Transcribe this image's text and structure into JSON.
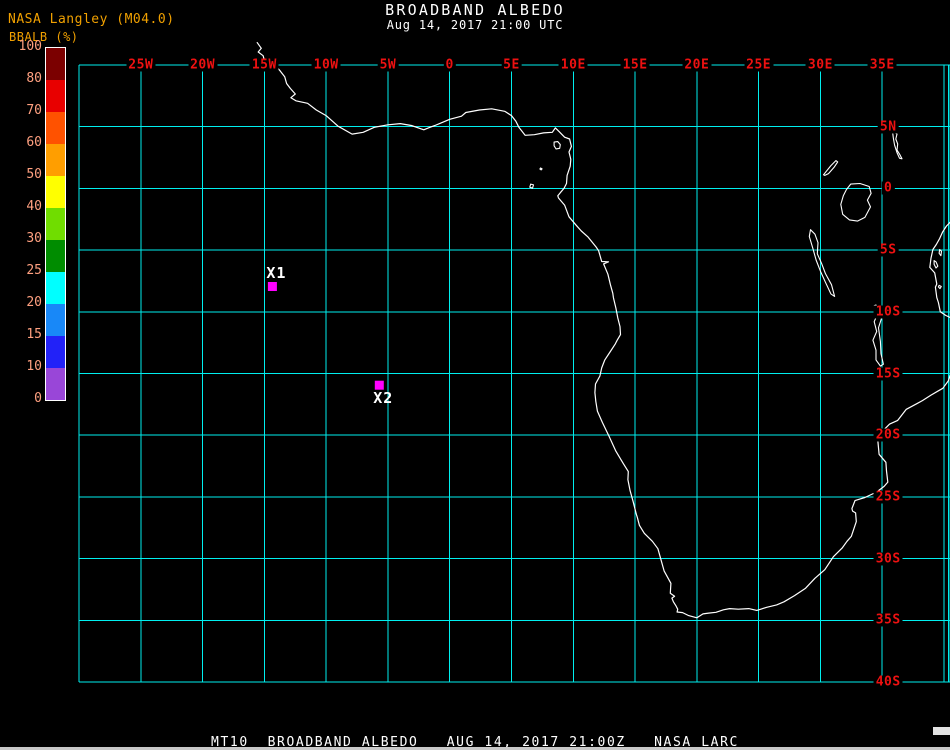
{
  "header": {
    "source": "NASA Langley (M04.0)",
    "title": "BROADBAND ALBEDO",
    "subtitle": "Aug 14, 2017 21:00 UTC"
  },
  "colorbar": {
    "label": "BBALB (%)",
    "tick_values": [
      "100",
      "80",
      "70",
      "60",
      "50",
      "40",
      "30",
      "25",
      "20",
      "15",
      "10",
      "0"
    ],
    "segment_colors": [
      "#7B0000",
      "#E80000",
      "#FF5200",
      "#FF9E00",
      "#FFFF00",
      "#70DD00",
      "#008C00",
      "#00FFFF",
      "#1888F8",
      "#2222F8",
      "#9946D8"
    ],
    "text_color": "#FFA080",
    "source_text_color": "#F0A000"
  },
  "map": {
    "lon_min": -30,
    "lon_max": 40,
    "lat_min": -40,
    "lat_max": 10,
    "grid_color": "#00EEEE",
    "label_color": "#EE1111",
    "coast_color": "#FFFFFF",
    "background": "#000000",
    "lon_labels": [
      {
        "text": "25W",
        "lon": -25
      },
      {
        "text": "20W",
        "lon": -20
      },
      {
        "text": "15W",
        "lon": -15
      },
      {
        "text": "10W",
        "lon": -10
      },
      {
        "text": "5W",
        "lon": -5
      },
      {
        "text": "0",
        "lon": 0
      },
      {
        "text": "5E",
        "lon": 5
      },
      {
        "text": "10E",
        "lon": 10
      },
      {
        "text": "15E",
        "lon": 15
      },
      {
        "text": "20E",
        "lon": 20
      },
      {
        "text": "25E",
        "lon": 25
      },
      {
        "text": "30E",
        "lon": 30
      },
      {
        "text": "35E",
        "lon": 35
      }
    ],
    "lat_labels": [
      {
        "text": "5N",
        "lat": 5
      },
      {
        "text": "0",
        "lat": 0
      },
      {
        "text": "5S",
        "lat": -5
      },
      {
        "text": "10S",
        "lat": -10
      },
      {
        "text": "15S",
        "lat": -15
      },
      {
        "text": "20S",
        "lat": -20
      },
      {
        "text": "25S",
        "lat": -25
      },
      {
        "text": "30S",
        "lat": -30
      },
      {
        "text": "35S",
        "lat": -35
      },
      {
        "text": "40S",
        "lat": -40
      }
    ],
    "markers": [
      {
        "label": "X1",
        "lon": -14.35,
        "lat": -7.95,
        "label_pos": "above",
        "color": "#FF00FF"
      },
      {
        "label": "X2",
        "lon": -5.7,
        "lat": -15.95,
        "label_pos": "below",
        "color": "#FF00FF"
      }
    ]
  },
  "geo": {
    "coastlines": [
      {
        "name": "africa-west-south-coast",
        "points": [
          [
            -15.6,
            11.85
          ],
          [
            -15.25,
            11.35
          ],
          [
            -15.5,
            11.05
          ],
          [
            -15.1,
            10.75
          ],
          [
            -14.95,
            10.2
          ],
          [
            -14.55,
            10.0
          ],
          [
            -14.0,
            9.85
          ],
          [
            -13.7,
            9.5
          ],
          [
            -13.35,
            9.05
          ],
          [
            -13.2,
            8.5
          ],
          [
            -12.9,
            8.1
          ],
          [
            -12.5,
            7.65
          ],
          [
            -12.85,
            7.35
          ],
          [
            -12.45,
            7.1
          ],
          [
            -11.5,
            6.9
          ],
          [
            -10.8,
            6.35
          ],
          [
            -10.0,
            5.9
          ],
          [
            -9.05,
            5.05
          ],
          [
            -7.9,
            4.4
          ],
          [
            -7.0,
            4.55
          ],
          [
            -6.1,
            4.95
          ],
          [
            -5.0,
            5.15
          ],
          [
            -4.0,
            5.25
          ],
          [
            -3.1,
            5.1
          ],
          [
            -2.1,
            4.75
          ],
          [
            -1.6,
            4.95
          ],
          [
            -1.2,
            5.1
          ],
          [
            -0.6,
            5.35
          ],
          [
            0.0,
            5.6
          ],
          [
            0.95,
            5.85
          ],
          [
            1.3,
            6.15
          ],
          [
            2.4,
            6.35
          ],
          [
            3.4,
            6.45
          ],
          [
            4.45,
            6.25
          ],
          [
            5.0,
            5.9
          ],
          [
            5.35,
            5.45
          ],
          [
            5.6,
            4.95
          ],
          [
            6.1,
            4.3
          ],
          [
            6.85,
            4.35
          ],
          [
            7.6,
            4.5
          ],
          [
            8.3,
            4.55
          ],
          [
            8.55,
            4.9
          ],
          [
            8.85,
            4.6
          ],
          [
            9.3,
            4.15
          ],
          [
            9.7,
            4.0
          ],
          [
            9.85,
            3.4
          ],
          [
            9.65,
            2.95
          ],
          [
            9.8,
            2.35
          ],
          [
            9.75,
            1.8
          ],
          [
            9.5,
            1.05
          ],
          [
            9.45,
            0.4
          ],
          [
            9.25,
            0.0
          ],
          [
            8.95,
            -0.35
          ],
          [
            8.75,
            -0.6
          ],
          [
            8.8,
            -0.78
          ],
          [
            9.3,
            -1.35
          ],
          [
            9.65,
            -2.3
          ],
          [
            10.2,
            -2.95
          ],
          [
            10.65,
            -3.45
          ],
          [
            11.2,
            -3.95
          ],
          [
            11.85,
            -4.75
          ],
          [
            12.05,
            -5.05
          ],
          [
            12.25,
            -5.75
          ],
          [
            12.3,
            -5.92
          ],
          [
            12.85,
            -5.95
          ],
          [
            12.45,
            -6.12
          ],
          [
            12.8,
            -6.95
          ],
          [
            13.0,
            -7.8
          ],
          [
            13.2,
            -8.5
          ],
          [
            13.25,
            -8.85
          ],
          [
            13.45,
            -9.7
          ],
          [
            13.6,
            -10.5
          ],
          [
            13.78,
            -11.2
          ],
          [
            13.82,
            -11.85
          ],
          [
            13.55,
            -12.3
          ],
          [
            13.4,
            -12.6
          ],
          [
            12.95,
            -13.3
          ],
          [
            12.55,
            -13.9
          ],
          [
            12.3,
            -14.55
          ],
          [
            12.15,
            -15.2
          ],
          [
            11.8,
            -15.85
          ],
          [
            11.75,
            -16.55
          ],
          [
            11.82,
            -17.25
          ],
          [
            11.95,
            -18.05
          ],
          [
            12.35,
            -18.95
          ],
          [
            12.9,
            -20.1
          ],
          [
            13.45,
            -21.3
          ],
          [
            14.05,
            -22.3
          ],
          [
            14.45,
            -22.95
          ],
          [
            14.42,
            -23.6
          ],
          [
            14.6,
            -24.5
          ],
          [
            14.85,
            -25.4
          ],
          [
            15.1,
            -26.4
          ],
          [
            15.18,
            -26.65
          ],
          [
            15.35,
            -27.3
          ],
          [
            15.75,
            -27.95
          ],
          [
            16.4,
            -28.6
          ],
          [
            16.85,
            -29.2
          ],
          [
            17.1,
            -30.1
          ],
          [
            17.35,
            -31.0
          ],
          [
            17.9,
            -32.0
          ],
          [
            17.85,
            -32.8
          ],
          [
            18.2,
            -33.05
          ],
          [
            17.98,
            -33.2
          ],
          [
            18.1,
            -33.5
          ],
          [
            18.32,
            -33.85
          ],
          [
            18.45,
            -34.1
          ],
          [
            18.4,
            -34.33
          ],
          [
            18.85,
            -34.38
          ],
          [
            19.3,
            -34.6
          ],
          [
            20.0,
            -34.8
          ],
          [
            20.5,
            -34.48
          ],
          [
            20.95,
            -34.42
          ],
          [
            21.55,
            -34.35
          ],
          [
            22.15,
            -34.15
          ],
          [
            22.65,
            -34.05
          ],
          [
            23.35,
            -34.1
          ],
          [
            24.2,
            -34.05
          ],
          [
            24.85,
            -34.2
          ],
          [
            25.65,
            -33.95
          ],
          [
            26.45,
            -33.75
          ],
          [
            27.05,
            -33.5
          ],
          [
            27.9,
            -33.0
          ],
          [
            28.8,
            -32.4
          ],
          [
            29.55,
            -31.6
          ],
          [
            30.35,
            -30.9
          ],
          [
            31.05,
            -29.85
          ],
          [
            31.75,
            -29.15
          ],
          [
            32.15,
            -28.6
          ],
          [
            32.5,
            -28.2
          ],
          [
            32.9,
            -27.0
          ],
          [
            32.85,
            -26.3
          ],
          [
            32.6,
            -26.15
          ],
          [
            32.55,
            -25.95
          ],
          [
            32.8,
            -25.3
          ],
          [
            33.6,
            -25.05
          ],
          [
            34.55,
            -24.6
          ],
          [
            35.15,
            -24.15
          ],
          [
            35.45,
            -23.8
          ],
          [
            35.35,
            -22.9
          ],
          [
            35.3,
            -22.2
          ],
          [
            34.75,
            -21.55
          ],
          [
            34.65,
            -20.5
          ],
          [
            34.85,
            -19.85
          ],
          [
            35.6,
            -19.1
          ],
          [
            36.25,
            -18.8
          ],
          [
            36.95,
            -17.9
          ],
          [
            37.8,
            -17.45
          ],
          [
            38.25,
            -17.2
          ],
          [
            38.95,
            -16.75
          ],
          [
            39.55,
            -16.4
          ],
          [
            39.9,
            -16.2
          ],
          [
            40.35,
            -15.6
          ],
          [
            40.6,
            -14.9
          ]
        ]
      },
      {
        "name": "africa-east-coast",
        "points": [
          [
            40.6,
            -10.5
          ],
          [
            40.15,
            -10.3
          ],
          [
            39.7,
            -10.0
          ],
          [
            39.55,
            -9.25
          ],
          [
            39.42,
            -8.85
          ],
          [
            39.3,
            -8.0
          ],
          [
            39.42,
            -7.75
          ],
          [
            39.25,
            -6.85
          ],
          [
            38.85,
            -6.4
          ],
          [
            38.95,
            -5.65
          ],
          [
            39.1,
            -4.95
          ],
          [
            39.38,
            -4.55
          ],
          [
            39.65,
            -4.05
          ],
          [
            39.88,
            -3.55
          ],
          [
            40.2,
            -3.05
          ],
          [
            40.6,
            -2.65
          ]
        ]
      }
    ],
    "lakes": [
      {
        "name": "lake-turkana",
        "points": [
          [
            36.0,
            4.55
          ],
          [
            36.2,
            4.4
          ],
          [
            36.1,
            4.0
          ],
          [
            36.25,
            3.6
          ],
          [
            36.2,
            3.1
          ],
          [
            36.45,
            2.7
          ],
          [
            36.6,
            2.4
          ],
          [
            36.4,
            2.45
          ],
          [
            36.2,
            2.9
          ],
          [
            36.0,
            3.5
          ],
          [
            35.9,
            4.1
          ],
          [
            35.85,
            4.5
          ]
        ]
      },
      {
        "name": "lake-albert",
        "points": [
          [
            30.35,
            1.05
          ],
          [
            30.65,
            1.2
          ],
          [
            31.1,
            1.7
          ],
          [
            31.4,
            2.15
          ],
          [
            31.25,
            2.25
          ],
          [
            30.85,
            1.85
          ],
          [
            30.45,
            1.35
          ],
          [
            30.25,
            1.1
          ]
        ]
      },
      {
        "name": "lake-victoria",
        "points": [
          [
            32.45,
            0.35
          ],
          [
            33.2,
            0.4
          ],
          [
            33.95,
            0.15
          ],
          [
            34.1,
            -0.4
          ],
          [
            33.8,
            -0.95
          ],
          [
            34.05,
            -1.5
          ],
          [
            33.6,
            -2.35
          ],
          [
            33.0,
            -2.65
          ],
          [
            32.35,
            -2.55
          ],
          [
            31.8,
            -2.1
          ],
          [
            31.65,
            -1.3
          ],
          [
            31.85,
            -0.6
          ],
          [
            32.1,
            -0.1
          ]
        ]
      },
      {
        "name": "lake-tanganyika",
        "points": [
          [
            29.2,
            -3.35
          ],
          [
            29.55,
            -3.7
          ],
          [
            29.8,
            -4.4
          ],
          [
            29.75,
            -5.3
          ],
          [
            30.1,
            -6.1
          ],
          [
            30.4,
            -6.9
          ],
          [
            30.9,
            -7.8
          ],
          [
            31.15,
            -8.75
          ],
          [
            30.85,
            -8.55
          ],
          [
            30.4,
            -7.6
          ],
          [
            30.0,
            -6.7
          ],
          [
            29.65,
            -5.8
          ],
          [
            29.4,
            -4.9
          ],
          [
            29.1,
            -3.9
          ]
        ]
      },
      {
        "name": "lake-malawi",
        "points": [
          [
            34.35,
            -9.5
          ],
          [
            34.65,
            -10.1
          ],
          [
            34.35,
            -10.8
          ],
          [
            34.55,
            -11.6
          ],
          [
            34.25,
            -12.3
          ],
          [
            34.5,
            -13.1
          ],
          [
            34.5,
            -13.9
          ],
          [
            34.85,
            -14.4
          ],
          [
            35.1,
            -14.25
          ],
          [
            34.9,
            -13.4
          ],
          [
            34.85,
            -12.4
          ],
          [
            34.7,
            -11.3
          ],
          [
            34.95,
            -10.5
          ],
          [
            34.65,
            -9.8
          ],
          [
            34.5,
            -9.45
          ]
        ]
      }
    ],
    "islands": [
      {
        "name": "bioko",
        "points": [
          [
            8.45,
            3.75
          ],
          [
            8.75,
            3.79
          ],
          [
            8.95,
            3.55
          ],
          [
            8.9,
            3.25
          ],
          [
            8.6,
            3.2
          ],
          [
            8.45,
            3.45
          ]
        ]
      },
      {
        "name": "principe",
        "points": [
          [
            7.35,
            1.65
          ],
          [
            7.48,
            1.58
          ],
          [
            7.4,
            1.5
          ],
          [
            7.3,
            1.57
          ]
        ]
      },
      {
        "name": "sao-tome",
        "points": [
          [
            6.55,
            0.35
          ],
          [
            6.78,
            0.28
          ],
          [
            6.7,
            0.02
          ],
          [
            6.48,
            0.1
          ]
        ]
      },
      {
        "name": "pemba-island",
        "points": [
          [
            39.65,
            -4.95
          ],
          [
            39.8,
            -5.1
          ],
          [
            39.75,
            -5.45
          ],
          [
            39.6,
            -5.25
          ]
        ]
      },
      {
        "name": "zanzibar",
        "points": [
          [
            39.2,
            -5.85
          ],
          [
            39.35,
            -5.95
          ],
          [
            39.5,
            -6.3
          ],
          [
            39.35,
            -6.45
          ],
          [
            39.2,
            -6.15
          ]
        ]
      },
      {
        "name": "mafia-island",
        "points": [
          [
            39.6,
            -7.85
          ],
          [
            39.78,
            -7.95
          ],
          [
            39.68,
            -8.12
          ],
          [
            39.55,
            -7.98
          ]
        ]
      }
    ]
  },
  "footer": {
    "text": "MT10  BROADBAND ALBEDO   AUG 14, 2017 21:00Z   NASA LARC"
  },
  "chrome": {
    "bottom_strip_color": "#C8C8C8",
    "corner_block_color": "#E2E2E2"
  }
}
